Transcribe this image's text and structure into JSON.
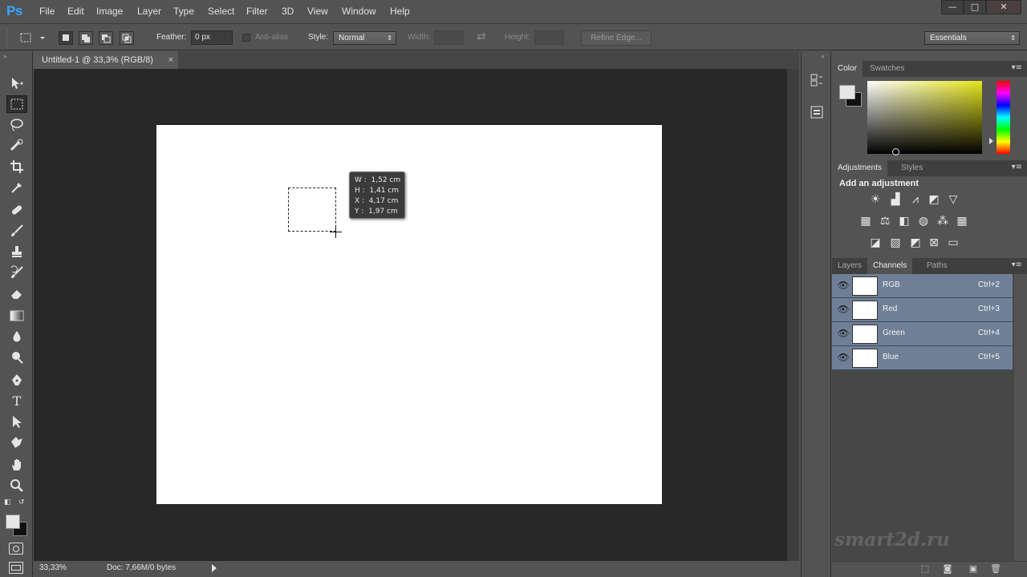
{
  "app": {
    "logo": "Ps",
    "menu": [
      "File",
      "Edit",
      "Image",
      "Layer",
      "Type",
      "Select",
      "Filter",
      "3D",
      "View",
      "Window",
      "Help"
    ],
    "window_controls": {
      "minimize": "—",
      "maximize": "□",
      "close": "✕"
    }
  },
  "options_bar": {
    "feather_label": "Feather:",
    "feather_value": "0 px",
    "antialias_label": "Anti-alias",
    "style_label": "Style:",
    "style_value": "Normal",
    "width_label": "Width:",
    "height_label": "Height:",
    "refine_edge_label": "Refine Edge...",
    "workspace_value": "Essentials"
  },
  "tools": [
    "move-tool",
    "rectangular-marquee-tool",
    "lasso-tool",
    "quick-selection-tool",
    "crop-tool",
    "eyedropper-tool",
    "spot-healing-brush-tool",
    "brush-tool",
    "clone-stamp-tool",
    "history-brush-tool",
    "eraser-tool",
    "gradient-tool",
    "blur-tool",
    "dodge-tool",
    "pen-tool",
    "type-tool",
    "path-selection-tool",
    "shape-tool",
    "hand-tool",
    "zoom-tool"
  ],
  "document": {
    "tab_title": "Untitled-1 @ 33,3% (RGB/8)",
    "tab_close": "×",
    "tooltip": {
      "w": "W :  1,52 cm",
      "h": "H :  1,41 cm",
      "x": "X :  4,17 cm",
      "y": "Y :  1,97 cm"
    }
  },
  "status": {
    "zoom": "33,33%",
    "doc_info": "Doc: 7,66M/0 bytes"
  },
  "panels": {
    "color_tabs": [
      "Color",
      "Swatches"
    ],
    "adjustments_tabs": [
      "Adjustments",
      "Styles"
    ],
    "adjustments_heading": "Add an adjustment",
    "layers_tabs": [
      "Layers",
      "Channels",
      "Paths"
    ],
    "channels": [
      {
        "name": "RGB",
        "shortcut": "Ctrl+2"
      },
      {
        "name": "Red",
        "shortcut": "Ctrl+3"
      },
      {
        "name": "Green",
        "shortcut": "Ctrl+4"
      },
      {
        "name": "Blue",
        "shortcut": "Ctrl+5"
      }
    ]
  },
  "watermark": "smart2d.ru",
  "colors": {
    "ui_bg": "#535353",
    "workspace": "#282828",
    "canvas": "#ffffff",
    "channel_selected": "#6f7f96",
    "ps_blue": "#31a8ff"
  }
}
